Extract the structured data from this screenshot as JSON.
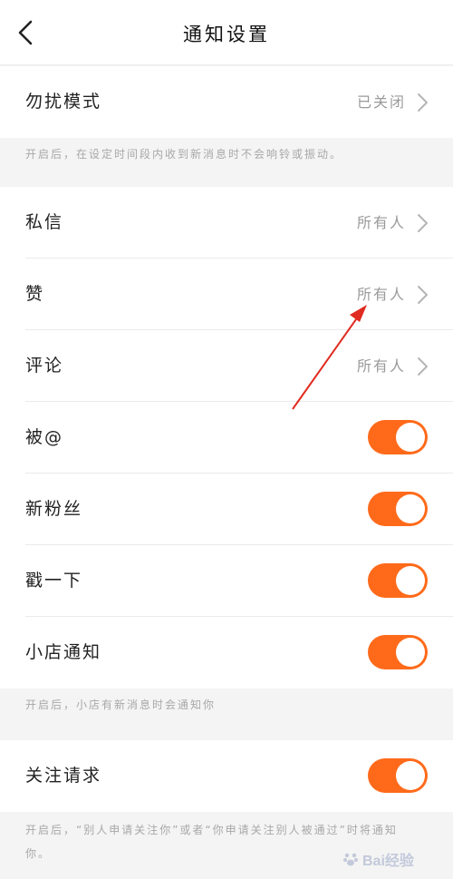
{
  "header": {
    "title": "通知设置"
  },
  "dnd": {
    "label": "勿扰模式",
    "value": "已关闭",
    "note": "开启后，在设定时间段内收到新消息时不会响铃或振动。"
  },
  "list": {
    "private": {
      "label": "私信",
      "value": "所有人"
    },
    "like": {
      "label": "赞",
      "value": "所有人"
    },
    "comment": {
      "label": "评论",
      "value": "所有人"
    },
    "mention": {
      "label": "被@",
      "on": true
    },
    "fans": {
      "label": "新粉丝",
      "on": true
    },
    "poke": {
      "label": "戳一下",
      "on": true
    },
    "shop": {
      "label": "小店通知",
      "on": true
    }
  },
  "shop_note": "开启后，小店有新消息时会通知你",
  "follow": {
    "label": "关注请求",
    "on": true,
    "note": "开启后，“别人申请关注你”或者“你申请关注别人被通过”时将通知你。"
  },
  "watermark": {
    "text": "Bai经验"
  },
  "colors": {
    "accent": "#ff6a1a",
    "annotation": "#e02b20"
  }
}
